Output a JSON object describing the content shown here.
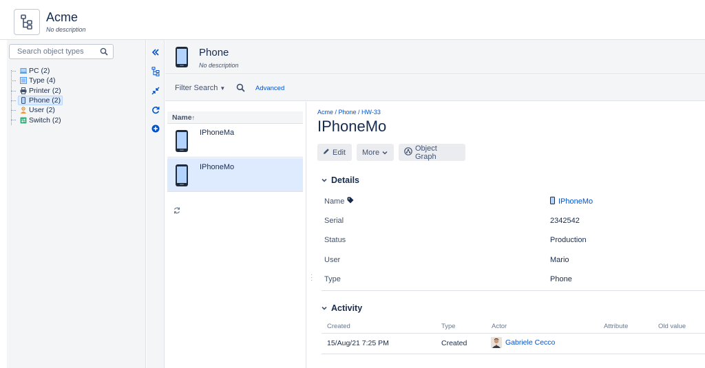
{
  "header": {
    "title": "Acme",
    "description": "No description",
    "icon": "tree-structure-icon"
  },
  "left_panel": {
    "search_placeholder": "Search object types",
    "tree": [
      {
        "label": "PC (2)",
        "icon": "pc-icon",
        "color": "#5e9ed6"
      },
      {
        "label": "Type (4)",
        "icon": "type-list-icon",
        "color": "#4c9aff"
      },
      {
        "label": "Printer (2)",
        "icon": "printer-icon",
        "color": "#42526e"
      },
      {
        "label": "Phone (2)",
        "icon": "phone-icon",
        "color": "#42526e",
        "selected": true
      },
      {
        "label": "User (2)",
        "icon": "user-icon",
        "color": "#f79232"
      },
      {
        "label": "Switch (2)",
        "icon": "switch-icon",
        "color": "#36b37e"
      }
    ]
  },
  "toolbar": {
    "icons": [
      "collapse-left-icon",
      "hierarchy-icon",
      "compress-icon",
      "refresh-icon",
      "add-icon"
    ]
  },
  "object_type": {
    "title": "Phone",
    "description": "No description",
    "icon": "phone-icon"
  },
  "filter": {
    "filter_search_label": "Filter Search",
    "advanced_label": "Advanced"
  },
  "list": {
    "column_header": "Name",
    "sort_indicator": "↑",
    "rows": [
      {
        "label": "IPhoneMa",
        "selected": false
      },
      {
        "label": "IPhoneMo",
        "selected": true
      }
    ]
  },
  "detail": {
    "breadcrumb": "Acme / Phone / HW-33",
    "title": "IPhoneMo",
    "buttons": {
      "edit": "Edit",
      "more": "More",
      "object_graph": "Object Graph"
    },
    "details_section": {
      "title": "Details",
      "attributes": [
        {
          "label": "Name",
          "value": "IPhoneMo"
        },
        {
          "label": "Serial",
          "value": "2342542"
        },
        {
          "label": "Status",
          "value": "Production"
        },
        {
          "label": "User",
          "value": "Mario"
        },
        {
          "label": "Type",
          "value": "Phone"
        }
      ]
    },
    "activity_section": {
      "title": "Activity",
      "columns": [
        "Created",
        "Type",
        "Actor",
        "Attribute",
        "Old value"
      ],
      "rows": [
        {
          "created": "15/Aug/21 7:25 PM",
          "type": "Created",
          "actor": "Gabriele Cecco",
          "attribute": "",
          "old_value": ""
        }
      ]
    }
  },
  "colors": {
    "accent": "#0052cc",
    "selected_bg": "#deebff",
    "panel_bg": "#f4f5f7"
  }
}
